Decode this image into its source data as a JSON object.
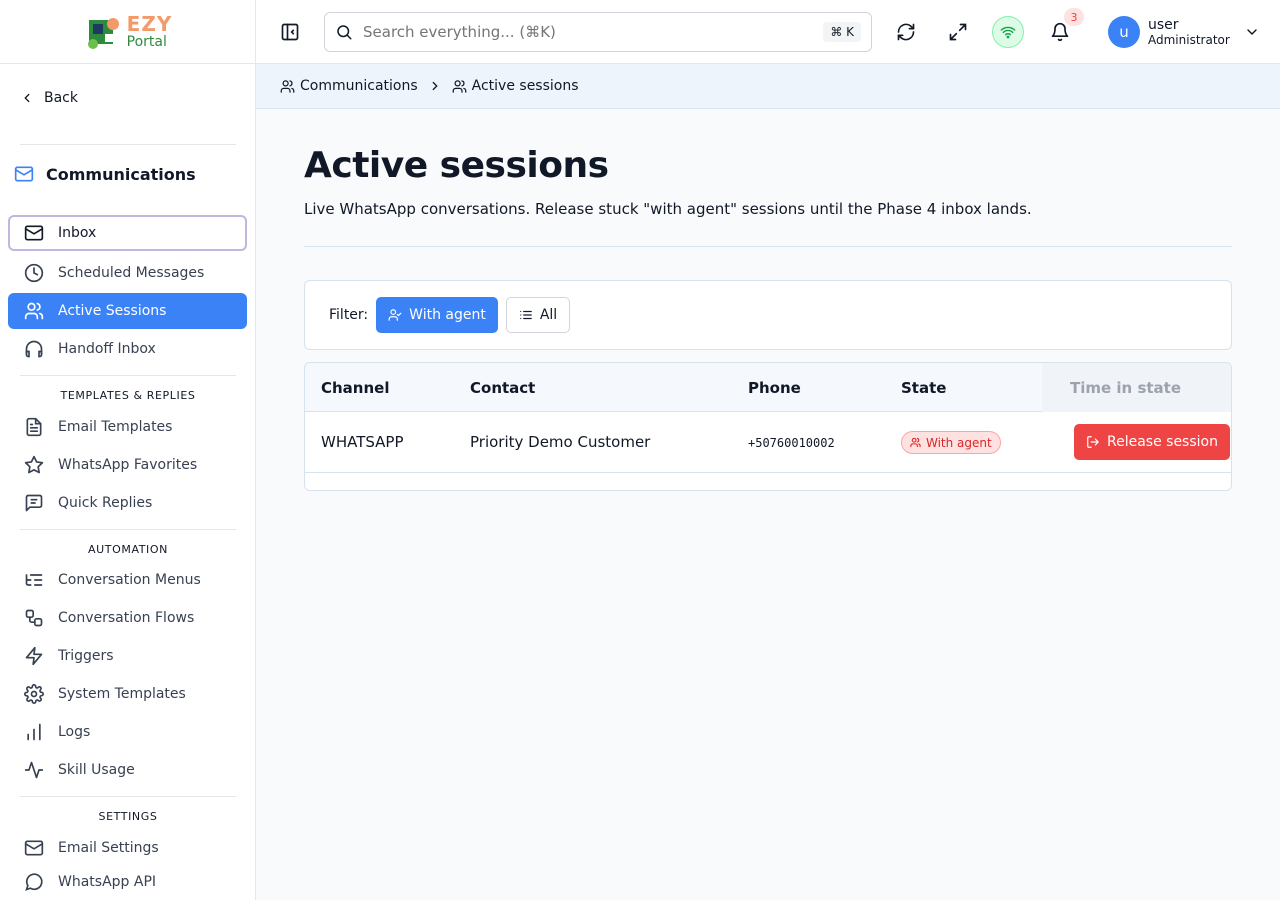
{
  "colors": {
    "accent": "#3b82f6",
    "danger": "#ef4444",
    "logo_orange": "#f39a6b",
    "logo_green": "#2e8b3d"
  },
  "logo": {
    "line1": "EZY",
    "line2": "Portal",
    "icon": "puzzle-logo-icon"
  },
  "sidebar": {
    "back_label": "Back",
    "section_title": "Communications",
    "section_icon": "mail-icon",
    "items": [
      {
        "label": "Inbox",
        "icon": "mail-icon"
      },
      {
        "label": "Scheduled Messages",
        "icon": "clock-icon"
      },
      {
        "label": "Active Sessions",
        "icon": "users-icon"
      },
      {
        "label": "Handoff Inbox",
        "icon": "headphones-icon"
      }
    ],
    "templates_group": "TEMPLATES & REPLIES",
    "templates_items": [
      {
        "label": "Email Templates",
        "icon": "file-text-icon"
      },
      {
        "label": "WhatsApp Favorites",
        "icon": "star-icon"
      },
      {
        "label": "Quick Replies",
        "icon": "message-square-icon"
      }
    ],
    "automation_group": "AUTOMATION",
    "automation_items": [
      {
        "label": "Conversation Menus",
        "icon": "list-tree-icon"
      },
      {
        "label": "Conversation Flows",
        "icon": "workflow-icon"
      },
      {
        "label": "Triggers",
        "icon": "zap-icon"
      },
      {
        "label": "System Templates",
        "icon": "gear-icon"
      },
      {
        "label": "Logs",
        "icon": "bar-chart-icon"
      },
      {
        "label": "Skill Usage",
        "icon": "activity-icon"
      }
    ],
    "settings_group": "SETTINGS",
    "settings_items": [
      {
        "label": "Email Settings",
        "icon": "mail-icon"
      },
      {
        "label": "WhatsApp API",
        "icon": "whatsapp-icon"
      }
    ]
  },
  "topbar": {
    "search_placeholder": "Search everything... (⌘K)",
    "search_shortcut": "⌘ K",
    "notification_count": "3",
    "user_name": "user",
    "user_role": "Administrator",
    "user_initial": "u"
  },
  "breadcrumb": {
    "items": [
      {
        "label": "Communications",
        "icon": "users-icon"
      },
      {
        "label": "Active sessions",
        "icon": "users-icon"
      }
    ]
  },
  "main": {
    "title": "Active sessions",
    "description": "Live WhatsApp conversations. Release stuck \"with agent\" sessions until the Phase 4 inbox lands.",
    "filter_label": "Filter:",
    "filter_with_agent": "With agent",
    "filter_all": "All",
    "table": {
      "headers": [
        "Channel",
        "Contact",
        "Phone",
        "State",
        "Time in state"
      ],
      "rows": [
        {
          "channel": "WHATSAPP",
          "contact": "Priority Demo Customer",
          "phone": "+50760010002",
          "state": "With agent",
          "action": "Release session"
        }
      ]
    }
  }
}
